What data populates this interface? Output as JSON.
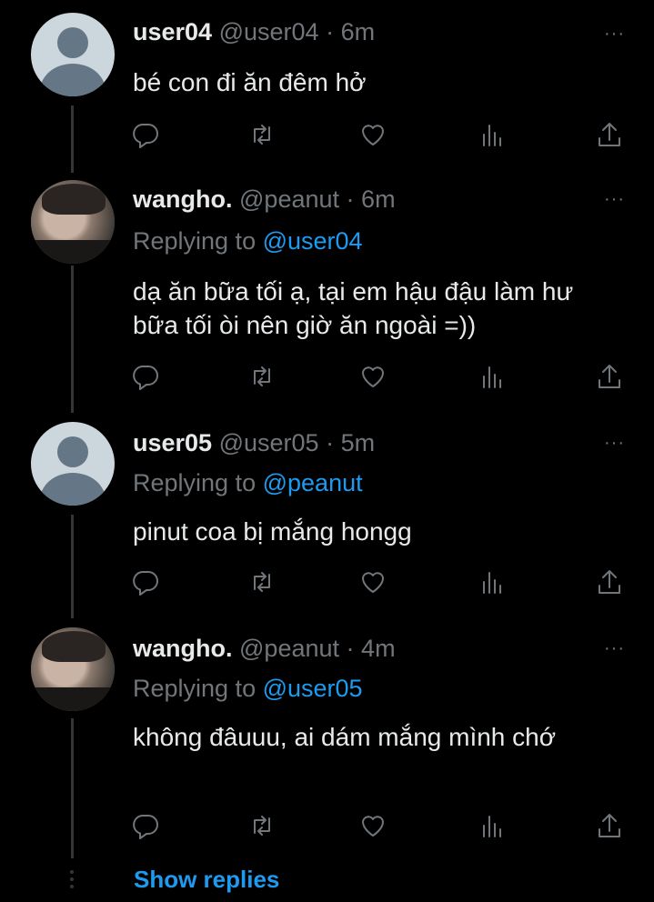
{
  "tweets": [
    {
      "name": "user04",
      "handle": "@user04",
      "dot": "·",
      "time": "6m",
      "replying_prefix": "",
      "replying_to": "",
      "text": "bé con đi ăn đêm hở",
      "avatar": "default"
    },
    {
      "name": "wangho.",
      "handle": "@peanut",
      "dot": "·",
      "time": "6m",
      "replying_prefix": "Replying to",
      "replying_to": "@user04",
      "text": "dạ ăn bữa tối ạ, tại em hậu đậu làm hư bữa tối òi nên giờ ăn ngoài =))",
      "avatar": "photo"
    },
    {
      "name": "user05",
      "handle": "@user05",
      "dot": "·",
      "time": "5m",
      "replying_prefix": "Replying to",
      "replying_to": "@peanut",
      "text": "pinut coa bị mắng hongg",
      "avatar": "default"
    },
    {
      "name": "wangho.",
      "handle": "@peanut",
      "dot": "·",
      "time": "4m",
      "replying_prefix": "Replying to",
      "replying_to": "@user05",
      "text": "không đâuuu, ai dám mắng mình chớ",
      "avatar": "photo"
    }
  ],
  "more_glyph": "···",
  "show_replies": "Show replies",
  "icons": [
    "reply-icon",
    "retweet-icon",
    "like-icon",
    "analytics-icon",
    "share-icon"
  ]
}
